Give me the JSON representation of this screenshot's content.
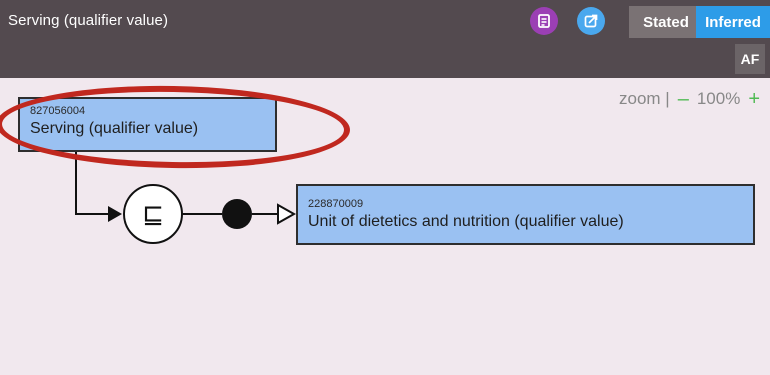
{
  "header": {
    "title": "Serving (qualifier value)",
    "stated_label": "Stated",
    "inferred_label": "Inferred",
    "af_label": "AF",
    "icons": [
      "list-icon",
      "external-link-icon"
    ],
    "colors": {
      "bar": "#534a4f",
      "purple": "#9b3fb4",
      "blue": "#4aa8ee",
      "active": "#2d9ce8"
    }
  },
  "zoom": {
    "label": "zoom |",
    "minus": "–",
    "value": "100%",
    "plus": "+"
  },
  "diagram": {
    "focus_concept": {
      "id": "827056004",
      "term": "Serving (qualifier value)"
    },
    "parent_concept": {
      "id": "228870009",
      "term": "Unit of dietetics and nutrition (qualifier value)"
    },
    "relation_symbol": "⊑",
    "colors": {
      "box": "#9ac1f2",
      "highlight": "#c0281f"
    }
  }
}
